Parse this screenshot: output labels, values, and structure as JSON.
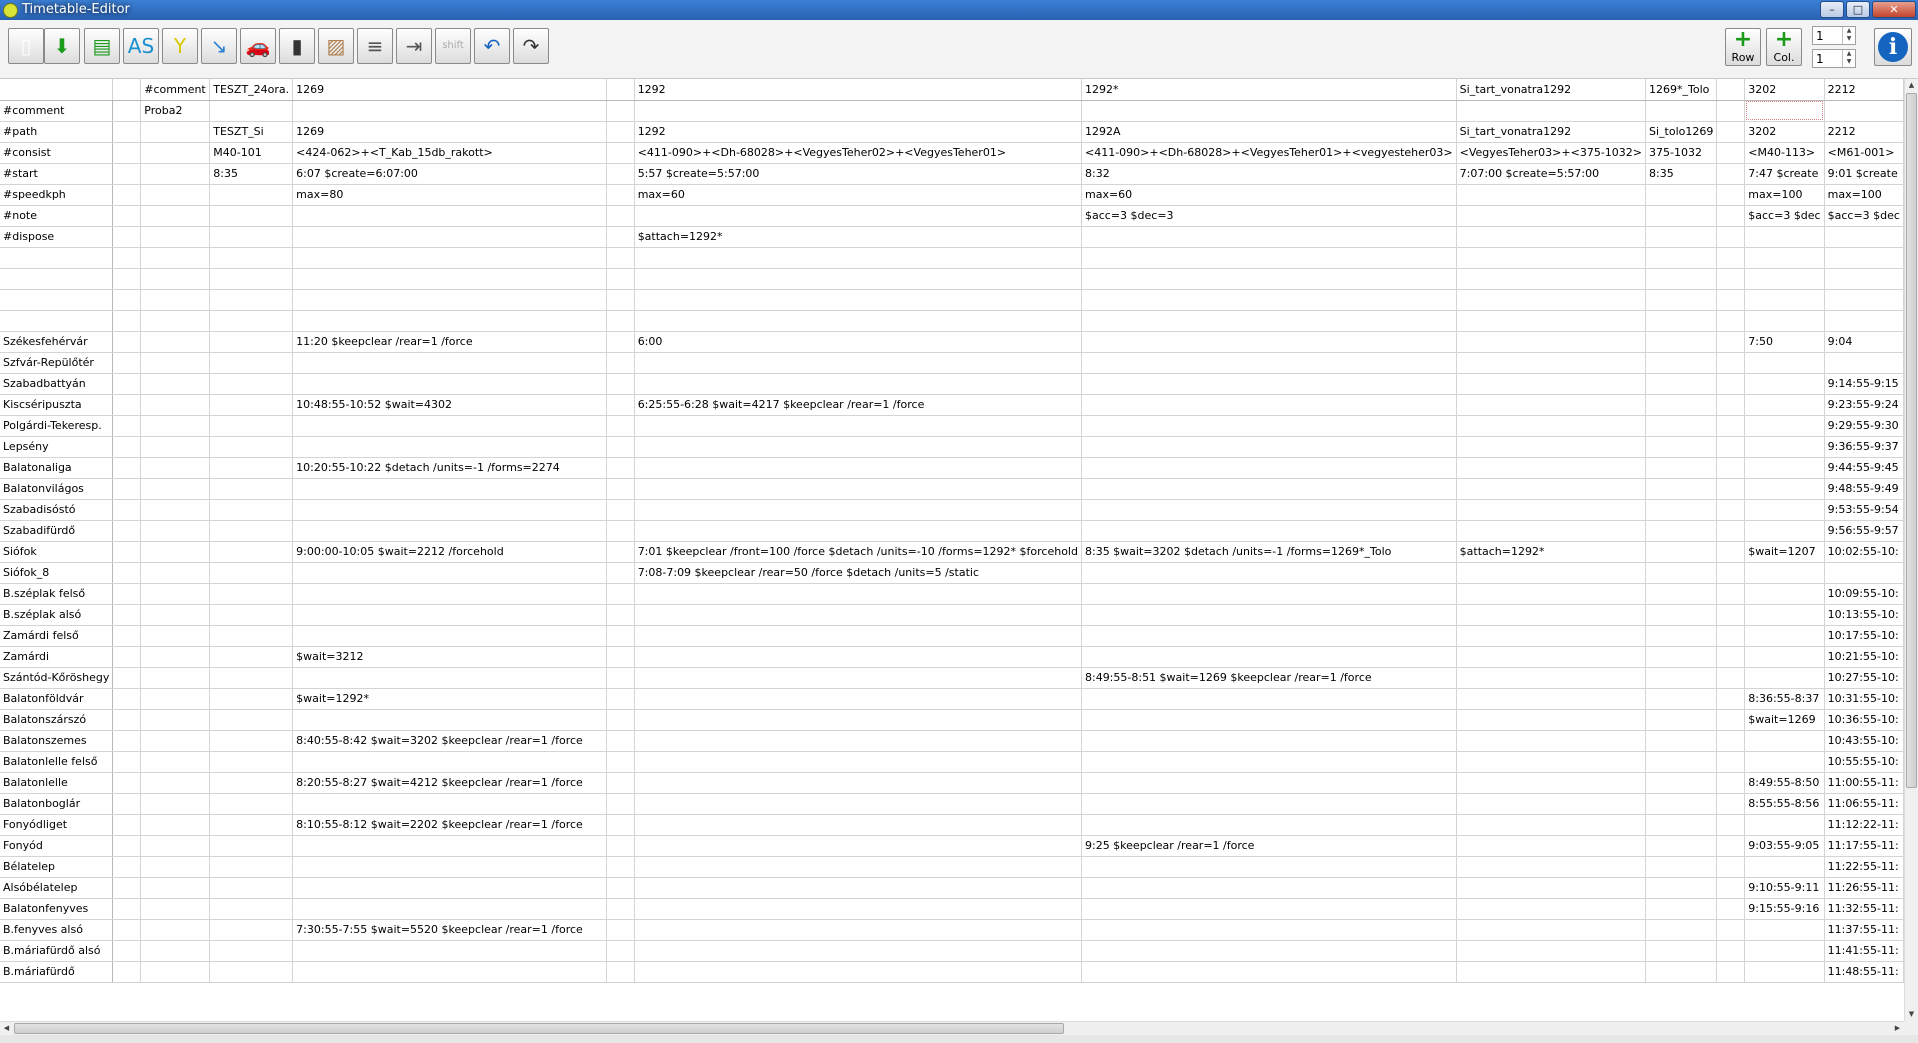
{
  "window": {
    "title": "Timetable-Editor",
    "controls": [
      "–",
      "□",
      "✕"
    ]
  },
  "toolbar": {
    "buttons": [
      {
        "icon": "new-document-icon",
        "glyph": "▯"
      },
      {
        "icon": "open-download-icon",
        "glyph": "⬇"
      },
      {
        "icon": "save-icon",
        "glyph": "▤"
      },
      {
        "icon": "save-as-icon",
        "glyph": "AS"
      },
      {
        "icon": "junction-icon",
        "glyph": "Y"
      },
      {
        "icon": "import-arrow-icon",
        "glyph": "↘"
      },
      {
        "icon": "train-car-icon",
        "glyph": "🚗"
      },
      {
        "icon": "signal-icon",
        "glyph": "▮"
      },
      {
        "icon": "track-icon",
        "glyph": "▨"
      },
      {
        "icon": "lines-icon",
        "glyph": "≡"
      },
      {
        "icon": "indent-icon",
        "glyph": "⇥"
      },
      {
        "icon": "shift-icon",
        "label": "shift"
      },
      {
        "icon": "undo-icon",
        "glyph": "↶"
      },
      {
        "icon": "redo-icon",
        "glyph": "↷"
      }
    ],
    "add_row_label": "Row",
    "add_col_label": "Col.",
    "row_spin_value": "1",
    "col_spin_value": "1"
  },
  "grid": {
    "header": [
      "",
      "",
      "#comment",
      "TESZT_24ora.",
      "1269",
      "",
      "1292",
      "1292*",
      "Si_tart_vonatra1292",
      "1269*_Tolo",
      "",
      "3202",
      "2212"
    ],
    "rows": [
      [
        "#comment",
        "",
        "Proba2",
        "",
        "",
        "",
        "",
        "",
        "",
        "",
        "",
        "",
        ""
      ],
      [
        "#path",
        "",
        "",
        "TESZT_Si",
        "1269",
        "",
        "1292",
        "1292A",
        "Si_tart_vonatra1292",
        "Si_tolo1269",
        "",
        "3202",
        "2212"
      ],
      [
        "#consist",
        "",
        "",
        "M40-101",
        "<424-062>+<T_Kab_15db_rakott>",
        "",
        "<411-090>+<Dh-68028>+<VegyesTeher02>+<VegyesTeher01>",
        "<411-090>+<Dh-68028>+<VegyesTeher01>+<vegyesteher03>",
        "<VegyesTeher03>+<375-1032>",
        "375-1032",
        "",
        "<M40-113>",
        "<M61-001>"
      ],
      [
        "#start",
        "",
        "",
        "8:35",
        "6:07 $create=6:07:00",
        "",
        "5:57 $create=5:57:00",
        "8:32",
        "7:07:00 $create=5:57:00",
        "8:35",
        "",
        "7:47 $create",
        "9:01 $create"
      ],
      [
        "#speedkph",
        "",
        "",
        "",
        "max=80",
        "",
        "max=60",
        "max=60",
        "",
        "",
        "",
        "max=100",
        "max=100"
      ],
      [
        "#note",
        "",
        "",
        "",
        "",
        "",
        "",
        "$acc=3 $dec=3",
        "",
        "",
        "",
        "$acc=3 $dec",
        "$acc=3 $dec"
      ],
      [
        "#dispose",
        "",
        "",
        "",
        "",
        "",
        "$attach=1292*",
        "",
        "",
        "",
        "",
        "",
        ""
      ],
      [
        "",
        "",
        "",
        "",
        "",
        "",
        "",
        "",
        "",
        "",
        "",
        "",
        ""
      ],
      [
        "",
        "",
        "",
        "",
        "",
        "",
        "",
        "",
        "",
        "",
        "",
        "",
        ""
      ],
      [
        "",
        "",
        "",
        "",
        "",
        "",
        "",
        "",
        "",
        "",
        "",
        "",
        ""
      ],
      [
        "",
        "",
        "",
        "",
        "",
        "",
        "",
        "",
        "",
        "",
        "",
        "",
        ""
      ],
      [
        "Székesfehérvár",
        "",
        "",
        "",
        "11:20 $keepclear /rear=1 /force",
        "",
        "6:00",
        "",
        "",
        "",
        "",
        "7:50",
        "9:04"
      ],
      [
        "Szfvár-Repülőtér",
        "",
        "",
        "",
        "",
        "",
        "",
        "",
        "",
        "",
        "",
        "",
        ""
      ],
      [
        "Szabadbattyán",
        "",
        "",
        "",
        "",
        "",
        "",
        "",
        "",
        "",
        "",
        "",
        "9:14:55-9:15"
      ],
      [
        "Kiscséripuszta",
        "",
        "",
        "",
        "10:48:55-10:52 $wait=4302",
        "",
        "6:25:55-6:28 $wait=4217 $keepclear /rear=1 /force",
        "",
        "",
        "",
        "",
        "",
        "9:23:55-9:24"
      ],
      [
        "Polgárdi-Tekeresp.",
        "",
        "",
        "",
        "",
        "",
        "",
        "",
        "",
        "",
        "",
        "",
        "9:29:55-9:30"
      ],
      [
        "Lepsény",
        "",
        "",
        "",
        "",
        "",
        "",
        "",
        "",
        "",
        "",
        "",
        "9:36:55-9:37"
      ],
      [
        "Balatonaliga",
        "",
        "",
        "",
        "10:20:55-10:22  $detach /units=-1 /forms=2274",
        "",
        "",
        "",
        "",
        "",
        "",
        "",
        "9:44:55-9:45"
      ],
      [
        "Balatonvilágos",
        "",
        "",
        "",
        "",
        "",
        "",
        "",
        "",
        "",
        "",
        "",
        "9:48:55-9:49"
      ],
      [
        "Szabadisóstó",
        "",
        "",
        "",
        "",
        "",
        "",
        "",
        "",
        "",
        "",
        "",
        "9:53:55-9:54"
      ],
      [
        "Szabadifürdő",
        "",
        "",
        "",
        "",
        "",
        "",
        "",
        "",
        "",
        "",
        "",
        "9:56:55-9:57"
      ],
      [
        "Siófok",
        "",
        "",
        "",
        "9:00:00-10:05 $wait=2212 /forcehold",
        "",
        "7:01 $keepclear /front=100 /force $detach /units=-10 /forms=1292* $forcehold",
        "8:35 $wait=3202 $detach /units=-1 /forms=1269*_Tolo",
        "$attach=1292*",
        "",
        "",
        "$wait=1207",
        "10:02:55-10:"
      ],
      [
        "Siófok_8",
        "",
        "",
        "",
        "",
        "",
        "7:08-7:09 $keepclear /rear=50 /force $detach /units=5 /static",
        "",
        "",
        "",
        "",
        "",
        ""
      ],
      [
        "B.széplak felső",
        "",
        "",
        "",
        "",
        "",
        "",
        "",
        "",
        "",
        "",
        "",
        "10:09:55-10:"
      ],
      [
        "B.széplak alsó",
        "",
        "",
        "",
        "",
        "",
        "",
        "",
        "",
        "",
        "",
        "",
        "10:13:55-10:"
      ],
      [
        "Zamárdi felső",
        "",
        "",
        "",
        "",
        "",
        "",
        "",
        "",
        "",
        "",
        "",
        "10:17:55-10:"
      ],
      [
        "Zamárdi",
        "",
        "",
        "",
        "$wait=3212",
        "",
        "",
        "",
        "",
        "",
        "",
        "",
        "10:21:55-10:"
      ],
      [
        "Szántód-Kőröshegy",
        "",
        "",
        "",
        "",
        "",
        "",
        "8:49:55-8:51 $wait=1269 $keepclear /rear=1 /force",
        "",
        "",
        "",
        "",
        "10:27:55-10:"
      ],
      [
        "Balatonföldvár",
        "",
        "",
        "",
        "$wait=1292*",
        "",
        "",
        "",
        "",
        "",
        "",
        "8:36:55-8:37",
        "10:31:55-10:"
      ],
      [
        "Balatonszárszó",
        "",
        "",
        "",
        "",
        "",
        "",
        "",
        "",
        "",
        "",
        "$wait=1269",
        "10:36:55-10:"
      ],
      [
        "Balatonszemes",
        "",
        "",
        "",
        "8:40:55-8:42 $wait=3202 $keepclear /rear=1 /force",
        "",
        "",
        "",
        "",
        "",
        "",
        "",
        "10:43:55-10:"
      ],
      [
        "Balatonlelle felső",
        "",
        "",
        "",
        "",
        "",
        "",
        "",
        "",
        "",
        "",
        "",
        "10:55:55-10:"
      ],
      [
        "Balatonlelle",
        "",
        "",
        "",
        "8:20:55-8:27 $wait=4212 $keepclear /rear=1 /force",
        "",
        "",
        "",
        "",
        "",
        "",
        "8:49:55-8:50",
        "11:00:55-11:"
      ],
      [
        "Balatonboglár",
        "",
        "",
        "",
        "",
        "",
        "",
        "",
        "",
        "",
        "",
        "8:55:55-8:56",
        "11:06:55-11:"
      ],
      [
        "Fonyódliget",
        "",
        "",
        "",
        "8:10:55-8:12 $wait=2202 $keepclear /rear=1 /force",
        "",
        "",
        "",
        "",
        "",
        "",
        "",
        "11:12:22-11:"
      ],
      [
        "Fonyód",
        "",
        "",
        "",
        "",
        "",
        "",
        "9:25 $keepclear /rear=1 /force",
        "",
        "",
        "",
        "9:03:55-9:05",
        "11:17:55-11:"
      ],
      [
        "Bélatelep",
        "",
        "",
        "",
        "",
        "",
        "",
        "",
        "",
        "",
        "",
        "",
        "11:22:55-11:"
      ],
      [
        "Alsóbélatelep",
        "",
        "",
        "",
        "",
        "",
        "",
        "",
        "",
        "",
        "",
        "9:10:55-9:11",
        "11:26:55-11:"
      ],
      [
        "Balatonfenyves",
        "",
        "",
        "",
        "",
        "",
        "",
        "",
        "",
        "",
        "",
        "9:15:55-9:16",
        "11:32:55-11:"
      ],
      [
        "B.fenyves alsó",
        "",
        "",
        "",
        "7:30:55-7:55 $wait=5520 $keepclear /rear=1 /force",
        "",
        "",
        "",
        "",
        "",
        "",
        "",
        "11:37:55-11:"
      ],
      [
        "B.máriafürdő alsó",
        "",
        "",
        "",
        "",
        "",
        "",
        "",
        "",
        "",
        "",
        "",
        "11:41:55-11:"
      ],
      [
        "B.máriafürdő",
        "",
        "",
        "",
        "",
        "",
        "",
        "",
        "",
        "",
        "",
        "",
        "11:48:55-11:"
      ]
    ]
  },
  "colors": {
    "titlebar": "#2a62b3",
    "grid_line": "#d4d4d4",
    "selection": "#e08080",
    "add_green": "#1a9b1a",
    "info_blue": "#1565c0"
  }
}
